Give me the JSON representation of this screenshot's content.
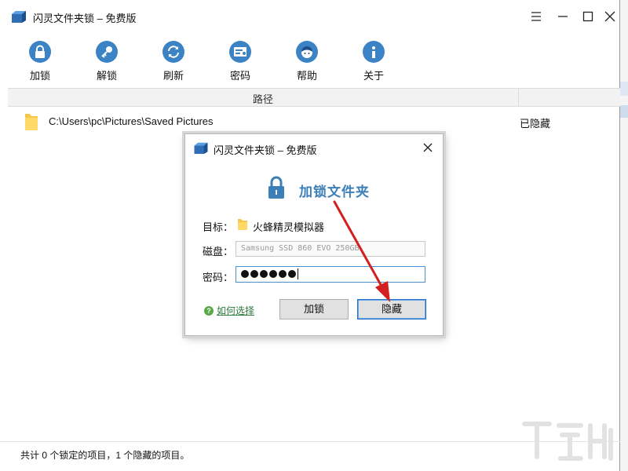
{
  "window": {
    "title": "闪灵文件夹锁 – 免费版"
  },
  "toolbar": {
    "items": [
      {
        "label": "加锁",
        "icon": "lock-icon"
      },
      {
        "label": "解锁",
        "icon": "key-icon"
      },
      {
        "label": "刷新",
        "icon": "refresh-icon"
      },
      {
        "label": "密码",
        "icon": "password-icon"
      },
      {
        "label": "帮助",
        "icon": "help-face-icon"
      },
      {
        "label": "关于",
        "icon": "info-icon"
      }
    ]
  },
  "list": {
    "header_path": "路径",
    "rows": [
      {
        "path": "C:\\Users\\pc\\Pictures\\Saved Pictures",
        "status": "已隐藏"
      }
    ]
  },
  "statusbar": {
    "text": "共计 0 个锁定的项目，1 个隐藏的项目。"
  },
  "dialog": {
    "title": "闪灵文件夹锁 – 免费版",
    "heading": "加锁文件夹",
    "target_label": "目标：",
    "target_value": "火蜂精灵模拟器",
    "disk_label": "磁盘：",
    "disk_value": "Samsung SSD 860 EVO 250GB",
    "password_label": "密码：",
    "password_masked_length": 6,
    "help_link": "如何选择",
    "lock_button": "加锁",
    "hide_button": "隐藏"
  },
  "colors": {
    "accent": "#3b83c4",
    "heading": "#3d7fb8",
    "arrow": "#d21f1f",
    "link": "#2d7a3a"
  }
}
